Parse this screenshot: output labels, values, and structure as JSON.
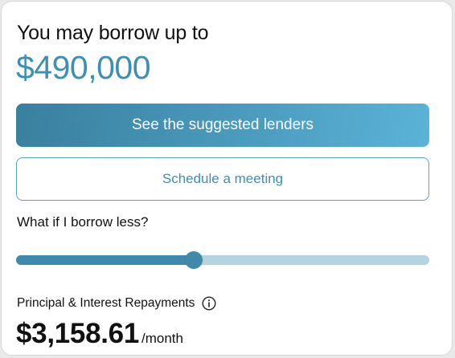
{
  "borrow": {
    "headline": "You may borrow up to",
    "amount": "$490,000"
  },
  "actions": {
    "primary_label": "See the suggested lenders",
    "secondary_label": "Schedule a meeting"
  },
  "slider": {
    "label": "What if I borrow less?",
    "value_fraction": 0.43
  },
  "repayment": {
    "label": "Principal & Interest Repayments",
    "info_icon": "info-circle-icon",
    "amount": "$3,158.61",
    "unit": "/month"
  },
  "colors": {
    "accent": "#3d8fb3",
    "track": "#b4d4e1"
  }
}
